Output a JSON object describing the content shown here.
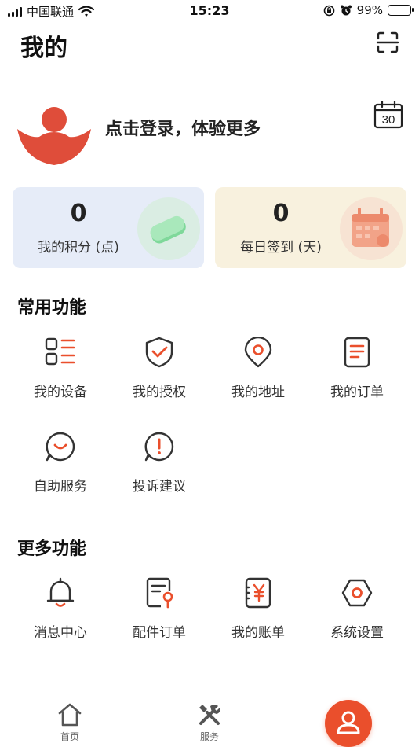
{
  "status_bar": {
    "carrier": "中国联通",
    "time": "15:23",
    "battery_percent": "99%",
    "battery_level": 0.99
  },
  "header": {
    "title": "我的",
    "scan_icon": "scan-icon"
  },
  "profile": {
    "login_prompt": "点击登录，体验更多",
    "calendar_icon": "calendar-icon",
    "calendar_day": "30"
  },
  "stats": {
    "points": {
      "value": "0",
      "label": "我的积分 (点)"
    },
    "signin": {
      "value": "0",
      "label": "每日签到 (天)"
    }
  },
  "common_functions": {
    "title": "常用功能",
    "items": [
      {
        "label": "我的设备",
        "icon": "device-list-icon"
      },
      {
        "label": "我的授权",
        "icon": "shield-check-icon"
      },
      {
        "label": "我的地址",
        "icon": "location-pin-icon"
      },
      {
        "label": "我的订单",
        "icon": "order-document-icon"
      },
      {
        "label": "自助服务",
        "icon": "smile-chat-icon"
      },
      {
        "label": "投诉建议",
        "icon": "exclamation-icon"
      }
    ]
  },
  "more_functions": {
    "title": "更多功能",
    "items": [
      {
        "label": "消息中心",
        "icon": "bell-icon"
      },
      {
        "label": "配件订单",
        "icon": "wrench-document-icon"
      },
      {
        "label": "我的账单",
        "icon": "yen-bill-icon"
      },
      {
        "label": "系统设置",
        "icon": "hexagon-settings-icon"
      }
    ]
  },
  "tab_bar": {
    "home": "首页",
    "service": "服务"
  },
  "colors": {
    "accent": "#ea4f2c",
    "icon_dark": "#333333",
    "points_card": "#e6ecf8",
    "signin_card": "#f8f1de"
  }
}
